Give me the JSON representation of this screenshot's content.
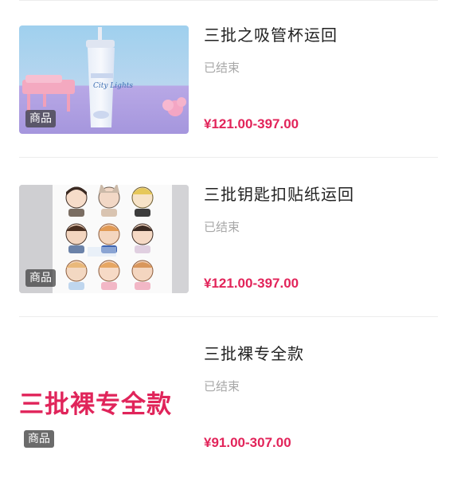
{
  "items": [
    {
      "title": "三批之吸管杯运回",
      "status": "已结束",
      "price": "¥121.00-397.00",
      "badge": "商品",
      "image_name": "straw-cup-photo",
      "cup_text": "City Lights"
    },
    {
      "title": "三批钥匙扣贴纸运回",
      "status": "已结束",
      "price": "¥121.00-397.00",
      "badge": "商品",
      "image_name": "keychain-sticker-photo"
    },
    {
      "title": "三批裸专全款",
      "status": "已结束",
      "price": "¥91.00-307.00",
      "badge": "商品",
      "thumb_text": "三批裸专全款"
    }
  ],
  "colors": {
    "price": "#e2245a",
    "title": "#222222",
    "status": "#a8a8a8"
  }
}
